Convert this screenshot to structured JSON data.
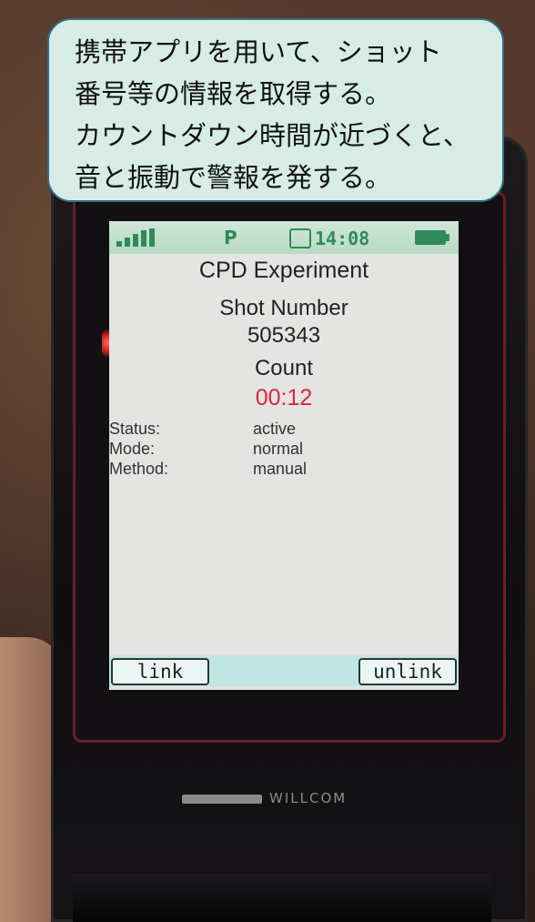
{
  "callout": {
    "lines": [
      "携帯アプリを用いて、ショット",
      "番号等の情報を取得する。",
      "カウントダウン時間が近づくと、",
      "音と振動で警報を発する。"
    ]
  },
  "status_bar": {
    "icons": [
      "antenna-icon",
      "p-icon",
      "clock-icon",
      "battery-icon"
    ],
    "p_glyph": "P",
    "clock_text": "14:08"
  },
  "screen": {
    "app_title": "CPD Experiment",
    "shot_label": "Shot Number",
    "shot_value": "505343",
    "count_label": "Count",
    "count_value": "00:12",
    "info": [
      {
        "key": "Status:",
        "value": "active"
      },
      {
        "key": "Mode:",
        "value": "normal"
      },
      {
        "key": "Method:",
        "value": "manual"
      }
    ]
  },
  "softkeys": {
    "left": "link",
    "right": "unlink"
  },
  "device": {
    "brand": "WILLCOM"
  },
  "colors": {
    "count_value": "#d8283a",
    "status_icons": "#2e8b57",
    "callout_bg": "#d6ece4",
    "callout_border": "#2f6f86",
    "softkey_bar": "#bfe6e2"
  }
}
